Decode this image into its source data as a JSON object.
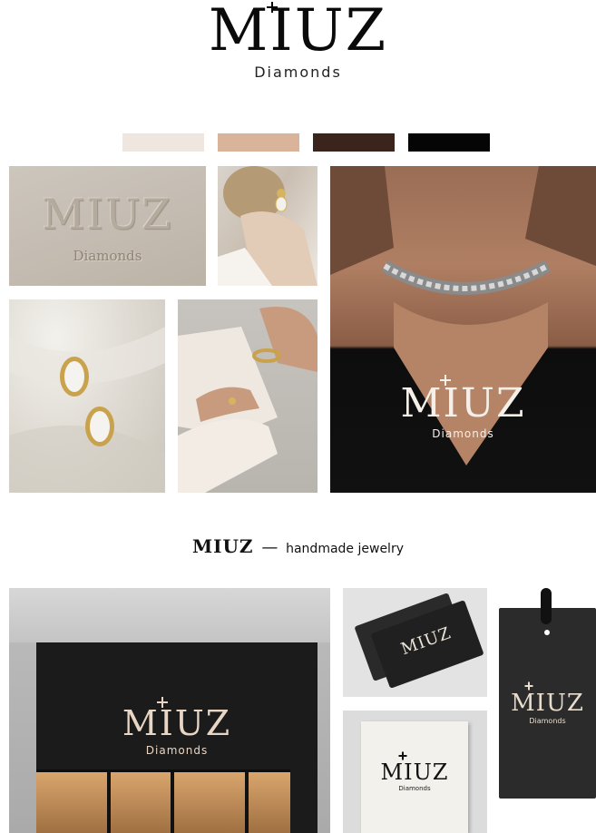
{
  "header": {
    "brand": "MIUZ",
    "subtitle": "Diamonds"
  },
  "palette": {
    "colors": [
      "#efe7df",
      "#d9b39a",
      "#3a241c",
      "#050505"
    ]
  },
  "moodboard": {
    "emboss_brand": "MIUZ",
    "emboss_sub": "Diamonds",
    "necklace_brand": "MIUZ",
    "necklace_sub": "Diamonds"
  },
  "tagline": {
    "brand": "MIUZ",
    "dash": "—",
    "text": "handmade jewelry"
  },
  "mockups": {
    "store_brand": "MIUZ",
    "store_sub": "Diamonds",
    "card_brand": "MIUZ",
    "box_brand": "MIUZ",
    "box_sub": "Diamonds",
    "tag_brand": "MIUZ",
    "tag_sub": "Diamonds"
  }
}
